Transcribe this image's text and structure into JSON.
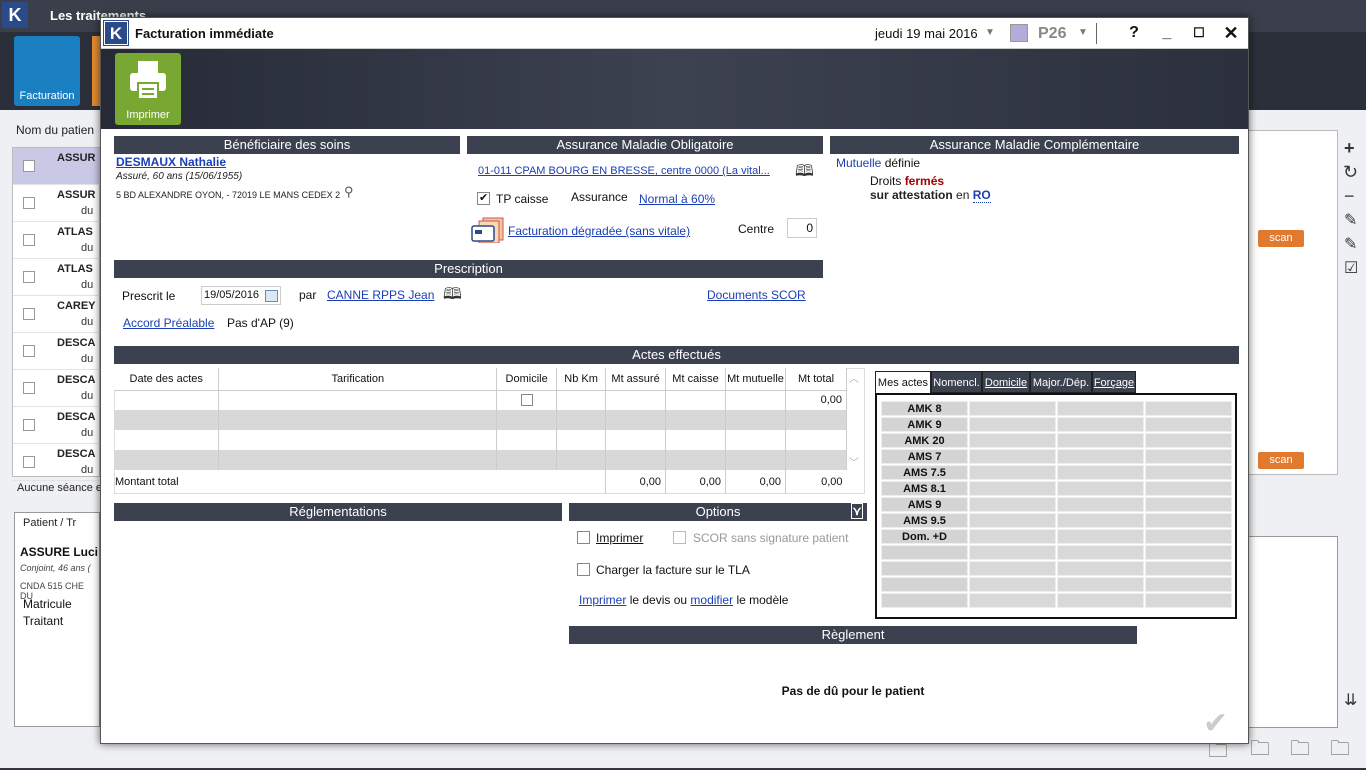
{
  "background": {
    "app_title": "Les traitements",
    "ribbon_facturation": "Facturation",
    "filter_label": "Nom du patien",
    "list_rows": [
      {
        "name": "ASSUR",
        "du": ""
      },
      {
        "name": "ASSUR",
        "du": "du"
      },
      {
        "name": "ATLAS",
        "du": "du"
      },
      {
        "name": "ATLAS",
        "du": "du"
      },
      {
        "name": "CAREY",
        "du": "du"
      },
      {
        "name": "DESCA",
        "du": "du"
      },
      {
        "name": "DESCA",
        "du": "du"
      },
      {
        "name": "DESCA",
        "du": "du"
      },
      {
        "name": "DESCA",
        "du": "du"
      }
    ],
    "no_session": "Aucune séance e",
    "patient_header": "Patient / Tr",
    "patient_name": "ASSURE Luci",
    "patient_sub": "Conjoint, 46 ans (",
    "patient_addr": "CNDA 515 CHE DU",
    "patient_matricule": "Matricule",
    "patient_traitant": "Traitant",
    "scan_label": "scan"
  },
  "dialog": {
    "title": "Facturation immédiate",
    "date": "jeudi 19 mai 2016",
    "poste": "P26",
    "poste_color": "#b3acd9",
    "help": "?",
    "print_label": "Imprimer"
  },
  "beneficiaire": {
    "header": "Bénéficiaire des soins",
    "name": "DESMAUX Nathalie",
    "info": "Assuré, 60 ans (15/06/1955)",
    "address": "5 BD ALEXANDRE OYON, - 72019 LE MANS CEDEX 2"
  },
  "amo": {
    "header": "Assurance Maladie Obligatoire",
    "caisse": "01-011 CPAM BOURG EN BRESSE, centre 0000 (La vital...",
    "tp_label": "TP caisse",
    "assurance_label": "Assurance",
    "assurance_value": "Normal à 60%",
    "degradee": "Facturation dégradée (sans vitale)",
    "centre_label": "Centre",
    "centre_value": "0"
  },
  "amc": {
    "header": "Assurance Maladie Complémentaire",
    "mutuelle_link": "Mutuelle",
    "mutuelle_text": "définie",
    "droits": "Droits",
    "fermes": "fermés",
    "attestation": "sur attestation",
    "en": "en",
    "ro": "RO"
  },
  "prescription": {
    "header": "Prescription",
    "prescrit_label": "Prescrit le",
    "date": "19/05/2016",
    "par": "par",
    "prescripteur": "CANNE RPPS Jean",
    "documents": "Documents SCOR",
    "accord": "Accord Préalable",
    "ap": "Pas d'AP (9)"
  },
  "actes": {
    "header": "Actes effectués",
    "columns": [
      "Date des actes",
      "Tarification",
      "Domicile",
      "Nb Km",
      "Mt assuré",
      "Mt caisse",
      "Mt mutuelle",
      "Mt total"
    ],
    "first_total": "0,00",
    "total_label": "Montant total",
    "totals": [
      "0,00",
      "0,00",
      "0,00",
      "0,00"
    ]
  },
  "tabs": [
    "Mes actes",
    "Nomencl.",
    "Domicile",
    "Major./Dép.",
    "Forçage"
  ],
  "codes": [
    "AMK 8",
    "AMK 9",
    "AMK 20",
    "AMS 7",
    "AMS 7.5",
    "AMS 8.1",
    "AMS 9",
    "AMS 9.5",
    "Dom. +D",
    "",
    "",
    "",
    ""
  ],
  "reglementations": {
    "header": "Réglementations"
  },
  "options": {
    "header": "Options",
    "imprimer": "Imprimer",
    "scor": "SCOR sans signature patient",
    "tla": "Charger la facture sur le TLA",
    "devis_imprimer": "Imprimer",
    "devis_text1": "le devis ou",
    "devis_modifier": "modifier",
    "devis_text2": "le modèle"
  },
  "reglement": {
    "header": "Règlement",
    "message": "Pas de dû pour le patient"
  }
}
